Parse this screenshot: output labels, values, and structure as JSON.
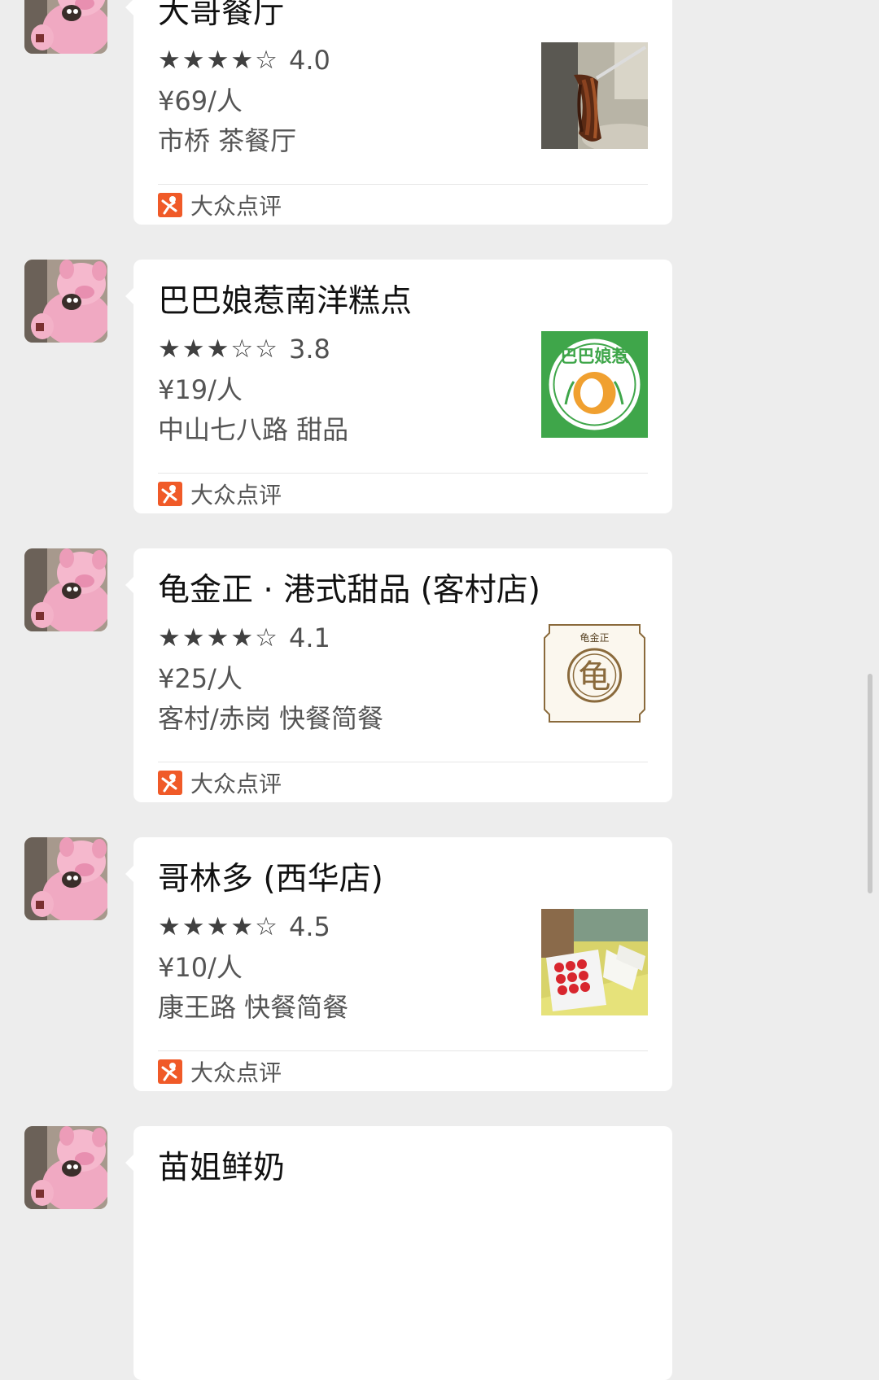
{
  "source_label": "大众点评",
  "cards": [
    {
      "name": "大哥餐厅",
      "stars": "★★★★☆",
      "score": "4.0",
      "price": "¥69/人",
      "area": "市桥 茶餐厅",
      "thumb_icon": "noodle-photo-icon"
    },
    {
      "name": "巴巴娘惹南洋糕点",
      "stars": "★★★☆☆",
      "score": "3.8",
      "price": "¥19/人",
      "area": "中山七八路 甜品",
      "thumb_icon": "nyonya-logo-icon",
      "logo_text": "巴巴娘惹"
    },
    {
      "name": "龟金正 · 港式甜品 (客村店)",
      "stars": "★★★★☆",
      "score": "4.1",
      "price": "¥25/人",
      "area": "客村/赤岗 快餐简餐",
      "thumb_icon": "guijinzheng-logo-icon",
      "logo_text": "龟金正"
    },
    {
      "name": "哥林多 (西华店)",
      "stars": "★★★★☆",
      "score": "4.5",
      "price": "¥10/人",
      "area": "康王路 快餐简餐",
      "thumb_icon": "dessert-photo-icon"
    },
    {
      "name": "苗姐鲜奶"
    }
  ],
  "colors": {
    "background": "#ededed",
    "bubble": "#ffffff",
    "dianping_orange": "#f05a28",
    "nyonya_green": "#3fa64a",
    "guijinzheng_brown": "#8a6a3c"
  }
}
